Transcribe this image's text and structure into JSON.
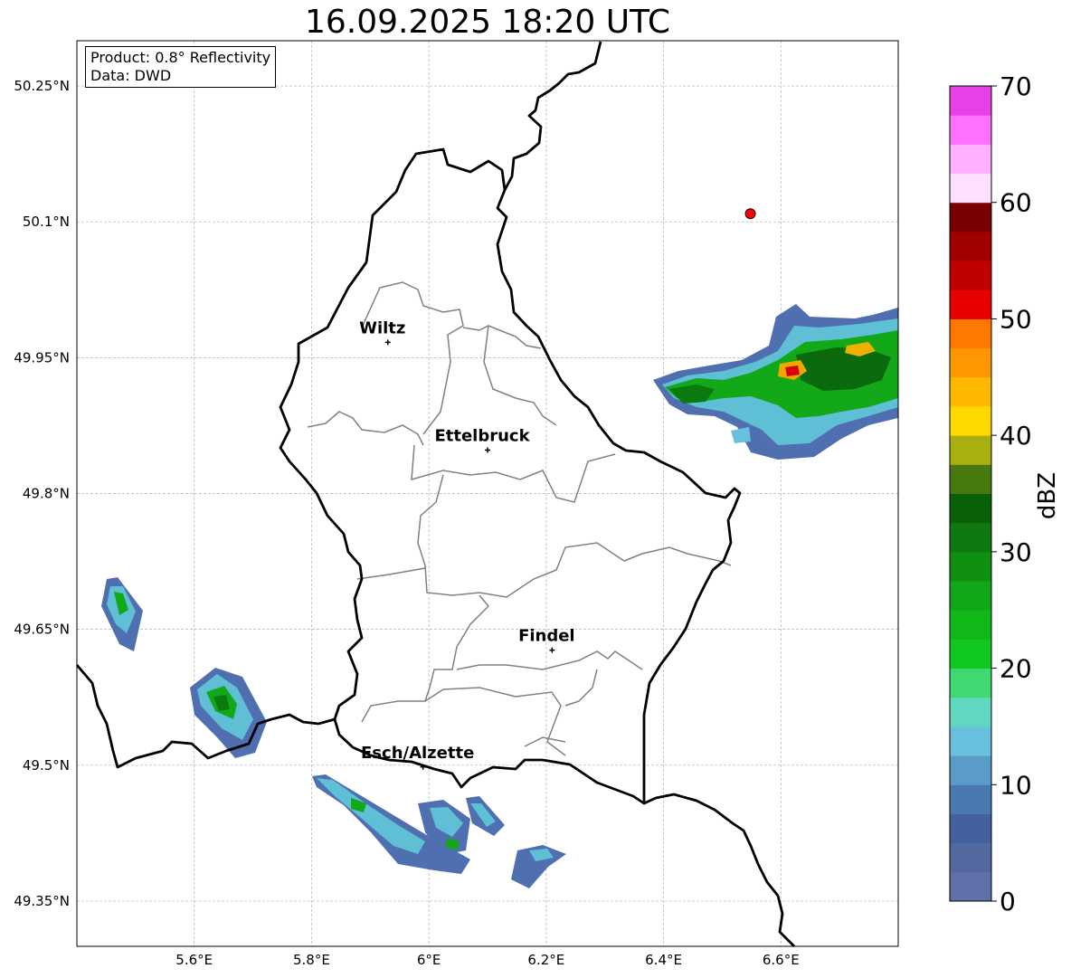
{
  "title": "16.09.2025 18:20 UTC",
  "info": {
    "product": "Product: 0.8° Reflectivity",
    "data": "Data: DWD"
  },
  "map": {
    "lon_ticks": [
      {
        "value": 5.6,
        "label": "5.6°E"
      },
      {
        "value": 5.8,
        "label": "5.8°E"
      },
      {
        "value": 6.0,
        "label": "6°E"
      },
      {
        "value": 6.2,
        "label": "6.2°E"
      },
      {
        "value": 6.4,
        "label": "6.4°E"
      },
      {
        "value": 6.6,
        "label": "6.6°E"
      }
    ],
    "lat_ticks": [
      {
        "value": 50.25,
        "label": "50.25°N"
      },
      {
        "value": 50.1,
        "label": "50.1°N"
      },
      {
        "value": 49.95,
        "label": "49.95°N"
      },
      {
        "value": 49.8,
        "label": "49.8°N"
      },
      {
        "value": 49.65,
        "label": "49.65°N"
      },
      {
        "value": 49.5,
        "label": "49.5°N"
      },
      {
        "value": 49.35,
        "label": "49.35°N"
      }
    ],
    "extent": {
      "lon": [
        5.4,
        6.8
      ],
      "lat": [
        49.3,
        50.3
      ]
    },
    "cities": [
      {
        "name": "Wiltz",
        "lon": 5.93,
        "lat": 49.967
      },
      {
        "name": "Ettelbruck",
        "lon": 6.1,
        "lat": 49.848
      },
      {
        "name": "Findel",
        "lon": 6.21,
        "lat": 49.627
      },
      {
        "name": "Esch/Alzette",
        "lon": 5.99,
        "lat": 49.498
      }
    ],
    "radar_site": {
      "lon": 6.548,
      "lat": 50.109,
      "color": "#ff0000"
    }
  },
  "colorbar": {
    "unit": "dBZ",
    "min": 0,
    "max": 70,
    "step": 2.5,
    "tick_labels": [
      "0",
      "10",
      "20",
      "30",
      "40",
      "50",
      "60",
      "70"
    ],
    "colors": [
      "#6070a8",
      "#5468a0",
      "#4460a0",
      "#4a78b0",
      "#5a9cc8",
      "#68c0dc",
      "#60d8c0",
      "#40d870",
      "#10c820",
      "#10b818",
      "#10a818",
      "#109010",
      "#107810",
      "#086008",
      "#487810",
      "#a8b010",
      "#ffd800",
      "#ffb800",
      "#ff9800",
      "#ff7800",
      "#e80000",
      "#c00000",
      "#a00000",
      "#780000",
      "#ffe0ff",
      "#ffb0ff",
      "#ff70ff",
      "#e840e8"
    ]
  }
}
